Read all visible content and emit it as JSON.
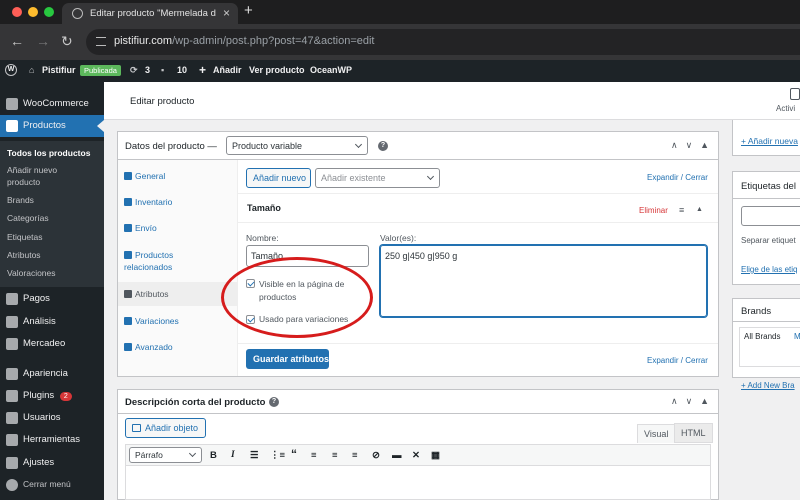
{
  "browser": {
    "tab_title": "Editar producto \"Mermelada d",
    "url_host": "pistifiur.com",
    "url_path": "/wp-admin/post.php?post=47&action=edit",
    "colors": {
      "close": "#ff5f57",
      "minimize": "#febc2e",
      "maximize": "#28c840"
    }
  },
  "adminbar": {
    "site_name": "Pistifiur",
    "status_badge": "Publicada",
    "updates_count": "3",
    "comments_count": "10",
    "new_label": "Añadir",
    "view_label": "Ver producto",
    "theme_label": "OceanWP"
  },
  "sidebar": {
    "woocommerce": "WooCommerce",
    "productos": "Productos",
    "submenu": [
      "Todos los productos",
      "Añadir nuevo producto",
      "Brands",
      "Categorías",
      "Etiquetas",
      "Atributos",
      "Valoraciones"
    ],
    "pagos": "Pagos",
    "analisis": "Análisis",
    "mercadeo": "Mercadeo",
    "apariencia": "Apariencia",
    "plugins": "Plugins",
    "plugins_count": "2",
    "usuarios": "Usuarios",
    "herramientas": "Herramientas",
    "ajustes": "Ajustes",
    "cerrar_menu": "Cerrar menú"
  },
  "header": {
    "title": "Editar producto",
    "activity_label": "Activi"
  },
  "product_data": {
    "label": "Datos del producto —",
    "type_selected": "Producto variable",
    "tabs": [
      "General",
      "Inventario",
      "Envío",
      "Productos relacionados",
      "Atributos",
      "Variaciones",
      "Avanzado"
    ],
    "add_new_button": "Añadir nuevo",
    "add_existing_placeholder": "Añadir existente",
    "expand_collapse": "Expandir / Cerrar",
    "attribute_title": "Tamaño",
    "remove_label": "Eliminar",
    "name_label": "Nombre:",
    "name_value": "Tamaño",
    "values_label": "Valor(es):",
    "values_value": "250 g|450 g|950 g",
    "visible_label": "Visible en la página de productos",
    "variations_label": "Usado para variaciones",
    "save_button": "Guardar atributos"
  },
  "short_description": {
    "title": "Descripción corta del producto",
    "add_media": "Añadir objeto",
    "tab_visual": "Visual",
    "tab_html": "HTML",
    "format_selected": "Párrafo"
  },
  "right_column": {
    "add_new_link": "+ Añadir nueva",
    "tags_title": "Etiquetas del",
    "tags_hint": "Separar etiquet",
    "tags_choose": "Elige de las etiq",
    "brands_title": "Brands",
    "brands_all": "All Brands",
    "brands_most": "M",
    "brands_add": "+ Add New Bra"
  }
}
